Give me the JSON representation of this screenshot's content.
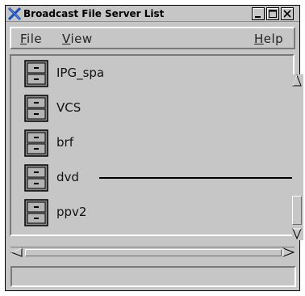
{
  "window": {
    "title": "Broadcast File Server List"
  },
  "titlebar": {
    "buttons": [
      "minimize-icon",
      "maximize-icon",
      "close-icon"
    ]
  },
  "menu": {
    "file": {
      "mnemonic": "F",
      "rest": "ile"
    },
    "view": {
      "mnemonic": "V",
      "rest": "iew"
    },
    "help": {
      "mnemonic": "H",
      "rest": "elp"
    }
  },
  "servers": [
    {
      "label": "IPG_spa",
      "icon": "file-cabinet-icon"
    },
    {
      "label": "VCS",
      "icon": "file-cabinet-icon"
    },
    {
      "label": "brf",
      "icon": "file-cabinet-icon"
    },
    {
      "label": "dvd",
      "icon": "file-cabinet-icon"
    },
    {
      "label": "ppv2",
      "icon": "file-cabinet-icon"
    }
  ],
  "status": {
    "text": ""
  },
  "colors": {
    "window_bg": "#c6c6c6",
    "title_icon": "#1a4fb4"
  }
}
